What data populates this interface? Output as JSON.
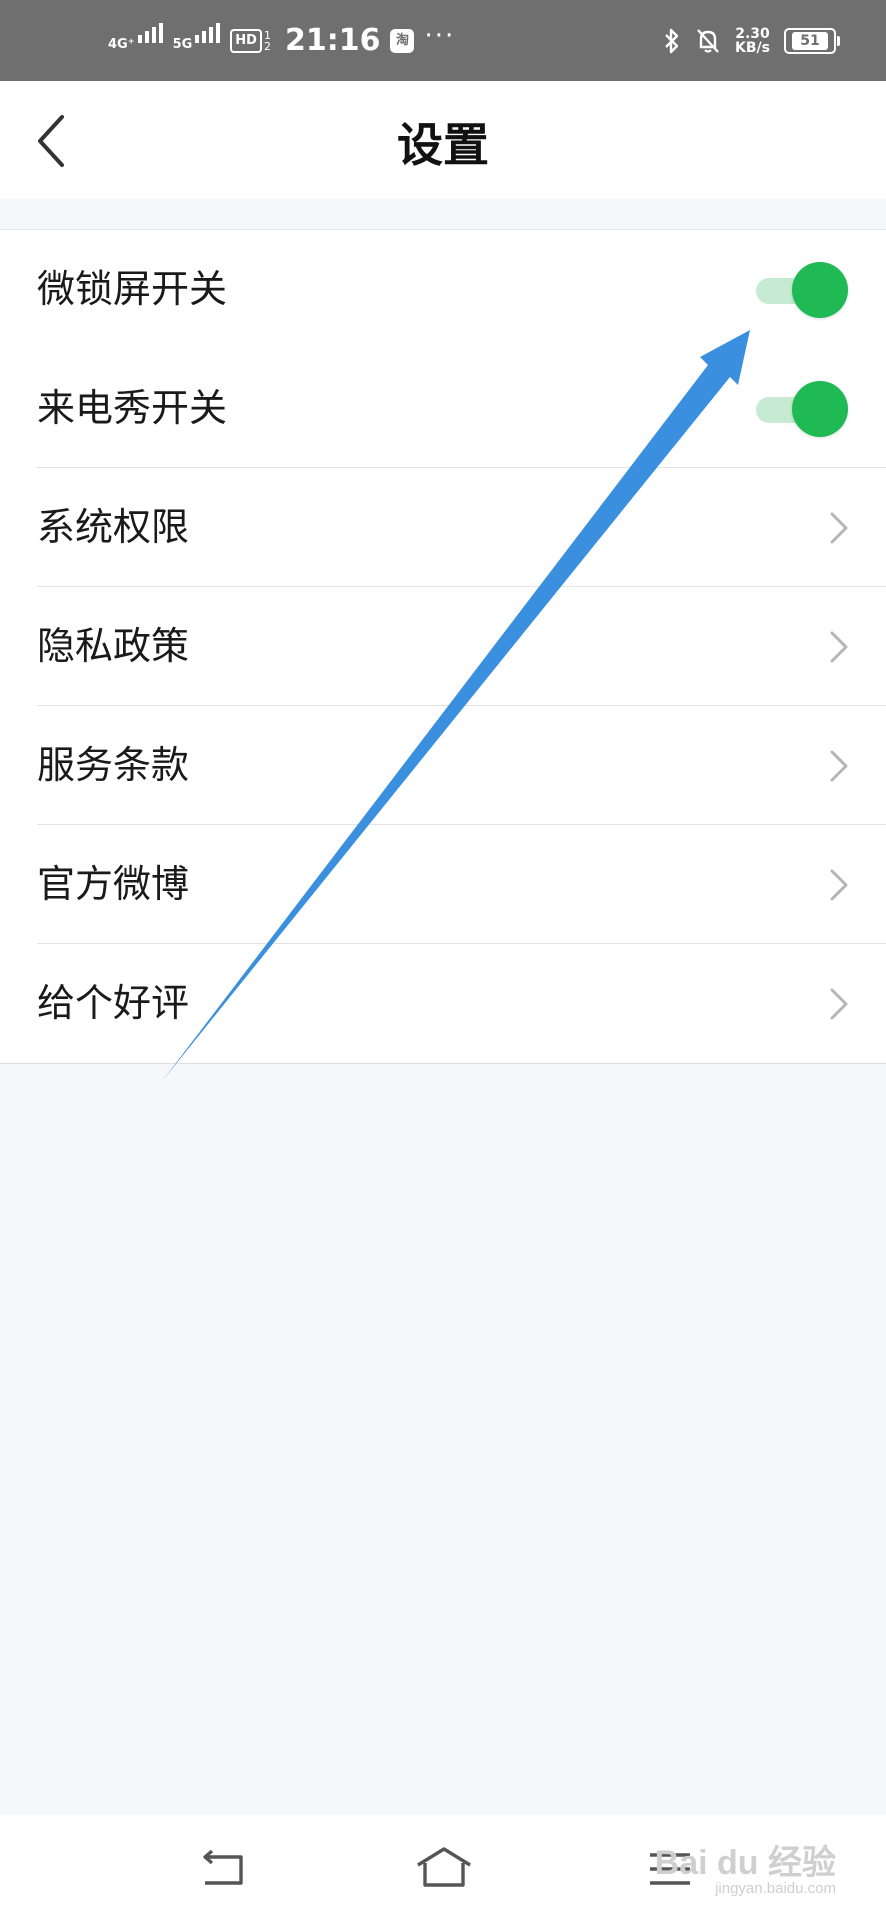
{
  "status_bar": {
    "sim1_label": "4G⁺",
    "sim2_label": "5G",
    "hd_label": "HD",
    "hd_frac_top": "1",
    "hd_frac_bottom": "2",
    "time": "21:16",
    "app_badge": "淘",
    "more_dots": "···",
    "net_speed": "2.30",
    "net_unit": "KB/s",
    "battery": "51"
  },
  "header": {
    "title": "设置"
  },
  "settings": {
    "items": [
      {
        "label": "微锁屏开关",
        "type": "toggle",
        "on": true
      },
      {
        "label": "来电秀开关",
        "type": "toggle",
        "on": true
      },
      {
        "label": "系统权限",
        "type": "link"
      },
      {
        "label": "隐私政策",
        "type": "link"
      },
      {
        "label": "服务条款",
        "type": "link"
      },
      {
        "label": "官方微博",
        "type": "link"
      },
      {
        "label": "给个好评",
        "type": "link"
      }
    ]
  },
  "annotation": {
    "arrow_color": "#3a8fdf"
  },
  "colors": {
    "toggle_on": "#1fba54",
    "toggle_track": "#c6ead2",
    "status_bar": "#6f6f6f"
  },
  "watermark": {
    "brand": "Bai du 经验",
    "domain": "jingyan.baidu.com"
  }
}
